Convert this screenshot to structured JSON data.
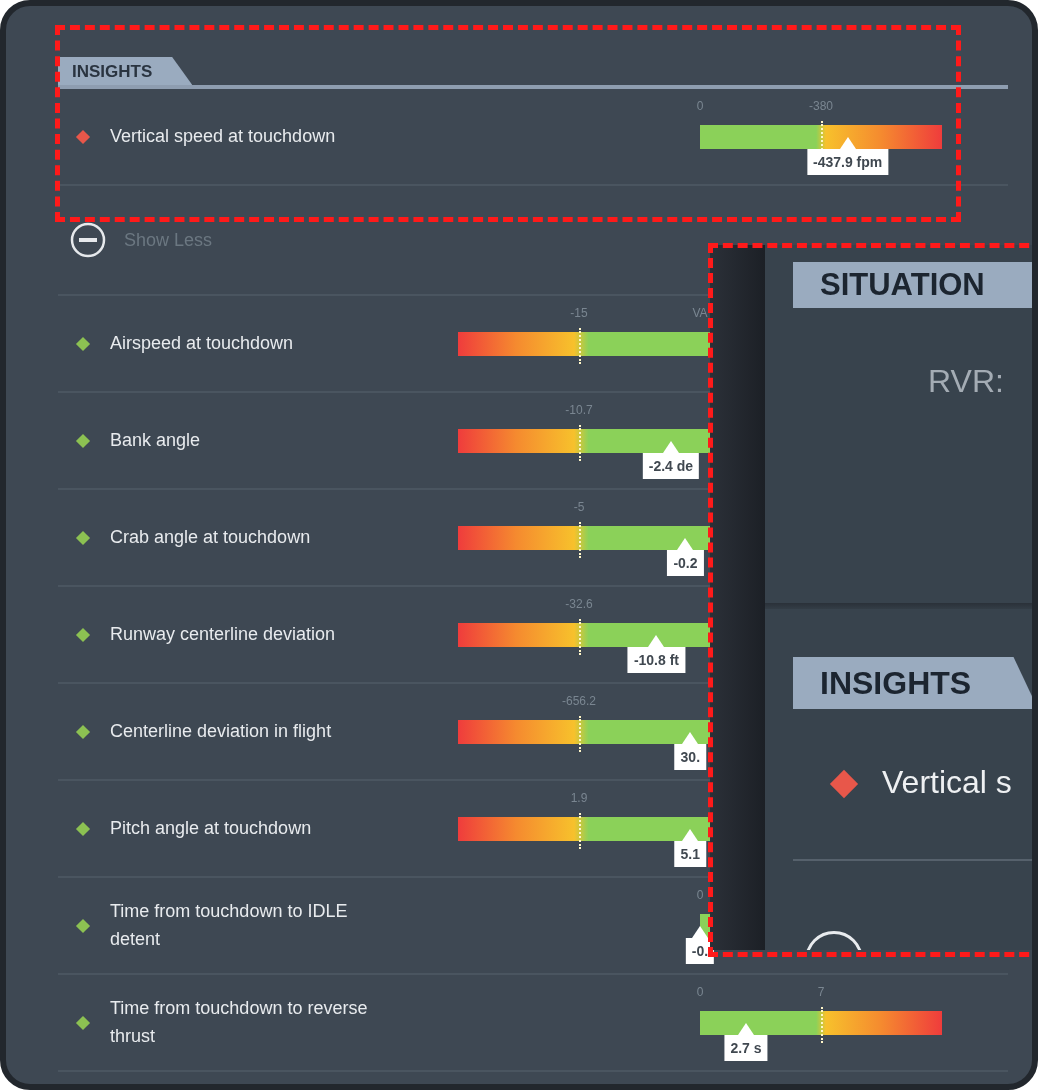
{
  "header": {
    "title": "INSIGHTS"
  },
  "primary": [
    {
      "kind": "ascending",
      "color": "#e8574a",
      "label": "Vertical speed at touchdown",
      "ticks": [
        "0",
        "-380"
      ],
      "level": 0.61,
      "value": "-437.9 fpm"
    }
  ],
  "toggle": {
    "label": "Show Less"
  },
  "rows": [
    {
      "kind": "descending",
      "color": "#8cc152",
      "label": "Airspeed at touchdown",
      "ticks": [
        "-15",
        "VA"
      ]
    },
    {
      "kind": "descending",
      "color": "#8cc152",
      "label": "Bank angle",
      "ticks": [
        "-10.7"
      ],
      "level": 0.44,
      "value": "-2.4 de"
    },
    {
      "kind": "descending",
      "color": "#8cc152",
      "label": "Crab angle at touchdown",
      "ticks": [
        "-5"
      ],
      "level": 0.47,
      "value": "-0.2"
    },
    {
      "kind": "descending",
      "color": "#8cc152",
      "label": "Runway centerline deviation",
      "ticks": [
        "-32.6"
      ],
      "level": 0.41,
      "value": "-10.8 ft"
    },
    {
      "kind": "descending",
      "color": "#8cc152",
      "label": "Centerline deviation in flight",
      "ticks": [
        "-656.2"
      ],
      "level": 0.48,
      "value": "30."
    },
    {
      "kind": "descending",
      "color": "#8cc152",
      "label": "Pitch angle at touchdown",
      "ticks": [
        "1.9"
      ],
      "level": 0.48,
      "value": "5.1"
    },
    {
      "kind": "ascending",
      "color": "#8cc152",
      "label": "Time from touchdown to IDLE detent",
      "ticks": [
        "0"
      ],
      "level": 0.0,
      "value": "-0."
    },
    {
      "kind": "ascending",
      "color": "#8cc152",
      "label": "Time from touchdown to reverse thrust",
      "ticks": [
        "0",
        "7"
      ],
      "level": 0.19,
      "value": "2.7 s"
    }
  ],
  "inset": {
    "situation_title": "SITUATION",
    "rvr_label": "RVR:",
    "insights_title": "INSIGHTS",
    "insight": {
      "color": "#e8574a",
      "label": "Vertical s"
    }
  }
}
